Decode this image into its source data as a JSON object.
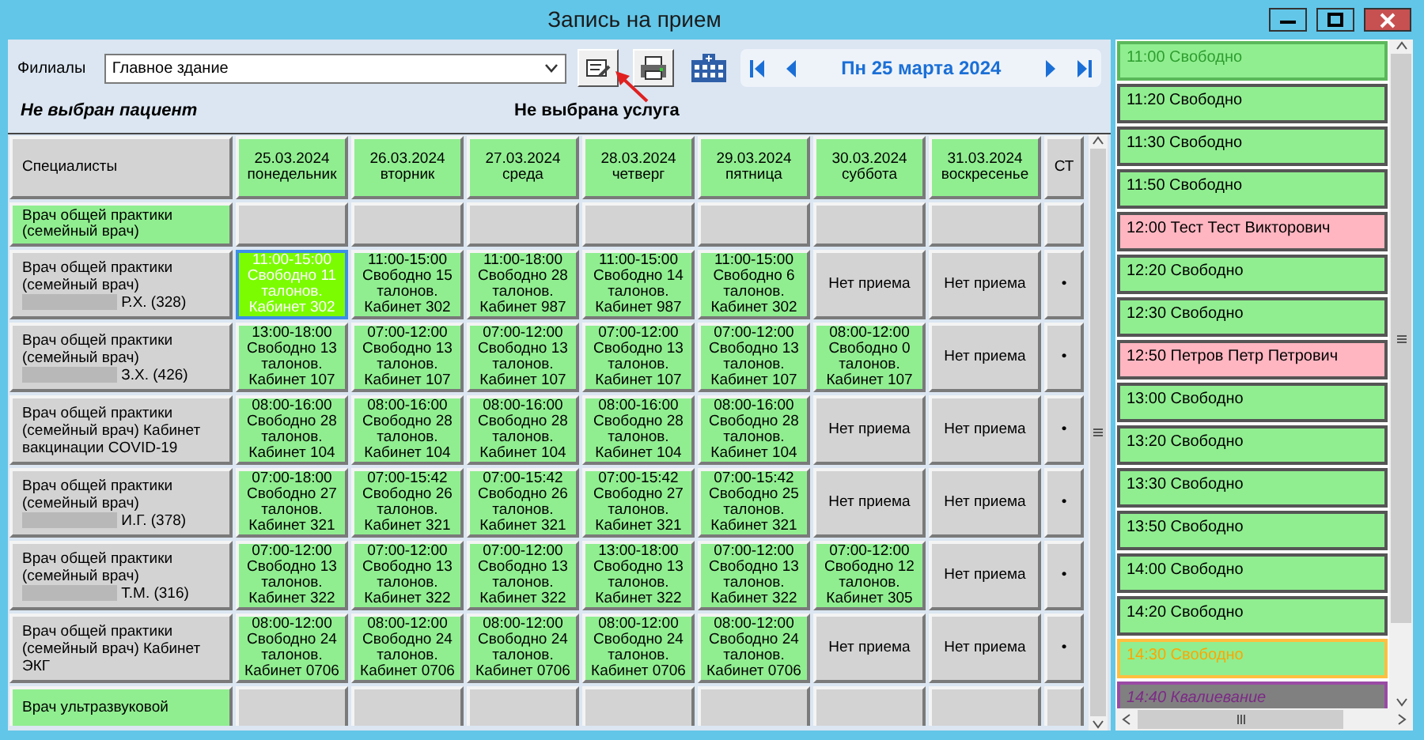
{
  "window": {
    "title": "Запись на прием"
  },
  "toolbar": {
    "branch_label": "Филиалы",
    "branch_value": "Главное здание",
    "date": "Пн 25 марта 2024"
  },
  "status": {
    "patient": "Не выбран пациент",
    "service": "Не выбрана услуга"
  },
  "table": {
    "columns": [
      {
        "kind": "spec",
        "lines": [
          "Специалисты"
        ]
      },
      {
        "kind": "day",
        "lines": [
          "25.03.2024",
          "понедельник"
        ]
      },
      {
        "kind": "day",
        "lines": [
          "26.03.2024",
          "вторник"
        ]
      },
      {
        "kind": "day",
        "lines": [
          "27.03.2024",
          "среда"
        ]
      },
      {
        "kind": "day",
        "lines": [
          "28.03.2024",
          "четверг"
        ]
      },
      {
        "kind": "day",
        "lines": [
          "29.03.2024",
          "пятница"
        ]
      },
      {
        "kind": "day",
        "lines": [
          "30.03.2024",
          "суббота"
        ]
      },
      {
        "kind": "day",
        "lines": [
          "31.03.2024",
          "воскресенье"
        ]
      },
      {
        "kind": "st",
        "lines": [
          "СТ"
        ]
      }
    ],
    "rows": [
      {
        "kind": "group",
        "name": "Врач общей практики (семейный врач)"
      },
      {
        "kind": "doctor",
        "name": "Врач общей практики (семейный врач)",
        "redacted": true,
        "initials": "Р.Х. (328)",
        "cells": [
          {
            "kind": "slot",
            "selected": true,
            "lines": [
              "11:00-15:00",
              "Свободно 11",
              "талонов.",
              "Кабинет 302"
            ]
          },
          {
            "kind": "slot",
            "selected": false,
            "lines": [
              "11:00-15:00",
              "Свободно 15",
              "талонов.",
              "Кабинет 302"
            ]
          },
          {
            "kind": "slot",
            "selected": false,
            "lines": [
              "11:00-18:00",
              "Свободно 28",
              "талонов.",
              "Кабинет 987"
            ]
          },
          {
            "kind": "slot",
            "selected": false,
            "lines": [
              "11:00-15:00",
              "Свободно 14",
              "талонов.",
              "Кабинет 987"
            ]
          },
          {
            "kind": "slot",
            "selected": false,
            "lines": [
              "11:00-15:00",
              "Свободно 6",
              "талонов.",
              "Кабинет 302"
            ]
          },
          {
            "kind": "none",
            "selected": false,
            "lines": [
              "Нет приема"
            ]
          },
          {
            "kind": "none",
            "selected": false,
            "lines": [
              "Нет приема"
            ]
          },
          {
            "kind": "st",
            "selected": false,
            "lines": [
              "•"
            ]
          }
        ]
      },
      {
        "kind": "doctor",
        "name": "Врач общей практики (семейный врач)",
        "redacted": true,
        "initials": "З.Х. (426)",
        "cells": [
          {
            "kind": "slot",
            "selected": false,
            "lines": [
              "13:00-18:00",
              "Свободно 13",
              "талонов.",
              "Кабинет 107"
            ]
          },
          {
            "kind": "slot",
            "selected": false,
            "lines": [
              "07:00-12:00",
              "Свободно 13",
              "талонов.",
              "Кабинет 107"
            ]
          },
          {
            "kind": "slot",
            "selected": false,
            "lines": [
              "07:00-12:00",
              "Свободно 13",
              "талонов.",
              "Кабинет 107"
            ]
          },
          {
            "kind": "slot",
            "selected": false,
            "lines": [
              "07:00-12:00",
              "Свободно 13",
              "талонов.",
              "Кабинет 107"
            ]
          },
          {
            "kind": "slot",
            "selected": false,
            "lines": [
              "07:00-12:00",
              "Свободно 13",
              "талонов.",
              "Кабинет 107"
            ]
          },
          {
            "kind": "slot",
            "selected": false,
            "lines": [
              "08:00-12:00",
              "Свободно 0",
              "талонов.",
              "Кабинет 107"
            ]
          },
          {
            "kind": "none",
            "selected": false,
            "lines": [
              "Нет приема"
            ]
          },
          {
            "kind": "st",
            "selected": false,
            "lines": [
              "•"
            ]
          }
        ]
      },
      {
        "kind": "doctor",
        "name": "Врач общей практики (семейный врач) Кабинет вакцинации COVID-19",
        "redacted": false,
        "cells": [
          {
            "kind": "slot",
            "selected": false,
            "lines": [
              "08:00-16:00",
              "Свободно 28",
              "талонов.",
              "Кабинет 104"
            ]
          },
          {
            "kind": "slot",
            "selected": false,
            "lines": [
              "08:00-16:00",
              "Свободно 28",
              "талонов.",
              "Кабинет 104"
            ]
          },
          {
            "kind": "slot",
            "selected": false,
            "lines": [
              "08:00-16:00",
              "Свободно 28",
              "талонов.",
              "Кабинет 104"
            ]
          },
          {
            "kind": "slot",
            "selected": false,
            "lines": [
              "08:00-16:00",
              "Свободно 28",
              "талонов.",
              "Кабинет 104"
            ]
          },
          {
            "kind": "slot",
            "selected": false,
            "lines": [
              "08:00-16:00",
              "Свободно 28",
              "талонов.",
              "Кабинет 104"
            ]
          },
          {
            "kind": "none",
            "selected": false,
            "lines": [
              "Нет приема"
            ]
          },
          {
            "kind": "none",
            "selected": false,
            "lines": [
              "Нет приема"
            ]
          },
          {
            "kind": "st",
            "selected": false,
            "lines": [
              "•"
            ]
          }
        ]
      },
      {
        "kind": "doctor",
        "name": "Врач общей практики (семейный врач)",
        "redacted": true,
        "initials": "И.Г. (378)",
        "cells": [
          {
            "kind": "slot",
            "selected": false,
            "lines": [
              "07:00-18:00",
              "Свободно 27",
              "талонов.",
              "Кабинет 321"
            ]
          },
          {
            "kind": "slot",
            "selected": false,
            "lines": [
              "07:00-15:42",
              "Свободно 26",
              "талонов.",
              "Кабинет 321"
            ]
          },
          {
            "kind": "slot",
            "selected": false,
            "lines": [
              "07:00-15:42",
              "Свободно 26",
              "талонов.",
              "Кабинет 321"
            ]
          },
          {
            "kind": "slot",
            "selected": false,
            "lines": [
              "07:00-15:42",
              "Свободно 27",
              "талонов.",
              "Кабинет 321"
            ]
          },
          {
            "kind": "slot",
            "selected": false,
            "lines": [
              "07:00-15:42",
              "Свободно 25",
              "талонов.",
              "Кабинет 321"
            ]
          },
          {
            "kind": "none",
            "selected": false,
            "lines": [
              "Нет приема"
            ]
          },
          {
            "kind": "none",
            "selected": false,
            "lines": [
              "Нет приема"
            ]
          },
          {
            "kind": "st",
            "selected": false,
            "lines": [
              "•"
            ]
          }
        ]
      },
      {
        "kind": "doctor",
        "name": "Врач общей практики (семейный врач)",
        "redacted": true,
        "initials": "Т.М. (316)",
        "cells": [
          {
            "kind": "slot",
            "selected": false,
            "lines": [
              "07:00-12:00",
              "Свободно 13",
              "талонов.",
              "Кабинет 322"
            ]
          },
          {
            "kind": "slot",
            "selected": false,
            "lines": [
              "07:00-12:00",
              "Свободно 13",
              "талонов.",
              "Кабинет 322"
            ]
          },
          {
            "kind": "slot",
            "selected": false,
            "lines": [
              "07:00-12:00",
              "Свободно 13",
              "талонов.",
              "Кабинет 322"
            ]
          },
          {
            "kind": "slot",
            "selected": false,
            "lines": [
              "13:00-18:00",
              "Свободно 13",
              "талонов.",
              "Кабинет 322"
            ]
          },
          {
            "kind": "slot",
            "selected": false,
            "lines": [
              "07:00-12:00",
              "Свободно 13",
              "талонов.",
              "Кабинет 322"
            ]
          },
          {
            "kind": "slot",
            "selected": false,
            "lines": [
              "07:00-12:00",
              "Свободно 12",
              "талонов.",
              "Кабинет 305"
            ]
          },
          {
            "kind": "none",
            "selected": false,
            "lines": [
              "Нет приема"
            ]
          },
          {
            "kind": "st",
            "selected": false,
            "lines": [
              "•"
            ]
          }
        ]
      },
      {
        "kind": "doctor",
        "name": "Врач общей практики (семейный врач) Кабинет ЭКГ",
        "redacted": false,
        "cells": [
          {
            "kind": "slot",
            "selected": false,
            "lines": [
              "08:00-12:00",
              "Свободно 24",
              "талонов.",
              "Кабинет 0706"
            ]
          },
          {
            "kind": "slot",
            "selected": false,
            "lines": [
              "08:00-12:00",
              "Свободно 24",
              "талонов.",
              "Кабинет 0706"
            ]
          },
          {
            "kind": "slot",
            "selected": false,
            "lines": [
              "08:00-12:00",
              "Свободно 24",
              "талонов.",
              "Кабинет 0706"
            ]
          },
          {
            "kind": "slot",
            "selected": false,
            "lines": [
              "08:00-12:00",
              "Свободно 24",
              "талонов.",
              "Кабинет 0706"
            ]
          },
          {
            "kind": "slot",
            "selected": false,
            "lines": [
              "08:00-12:00",
              "Свободно 24",
              "талонов.",
              "Кабинет 0706"
            ]
          },
          {
            "kind": "none",
            "selected": false,
            "lines": [
              "Нет приема"
            ]
          },
          {
            "kind": "none",
            "selected": false,
            "lines": [
              "Нет приема"
            ]
          },
          {
            "kind": "st",
            "selected": false,
            "lines": [
              "•"
            ]
          }
        ]
      },
      {
        "kind": "group",
        "name": "Врач ультразвуковой"
      }
    ]
  },
  "time_slots": [
    {
      "kind": "selected",
      "time": "11:00",
      "label": "Свободно"
    },
    {
      "kind": "free",
      "time": "11:20",
      "label": "Свободно"
    },
    {
      "kind": "free",
      "time": "11:30",
      "label": "Свободно"
    },
    {
      "kind": "free",
      "time": "11:50",
      "label": "Свободно"
    },
    {
      "kind": "booked",
      "time": "12:00",
      "label": "Тест Тест Викторович"
    },
    {
      "kind": "free",
      "time": "12:20",
      "label": "Свободно"
    },
    {
      "kind": "free",
      "time": "12:30",
      "label": "Свободно"
    },
    {
      "kind": "booked",
      "time": "12:50",
      "label": "Петров Петр Петрович"
    },
    {
      "kind": "free",
      "time": "13:00",
      "label": "Свободно"
    },
    {
      "kind": "free",
      "time": "13:20",
      "label": "Свободно"
    },
    {
      "kind": "free",
      "time": "13:30",
      "label": "Свободно"
    },
    {
      "kind": "free",
      "time": "13:50",
      "label": "Свободно"
    },
    {
      "kind": "free",
      "time": "14:00",
      "label": "Свободно"
    },
    {
      "kind": "free",
      "time": "14:20",
      "label": "Свободно"
    },
    {
      "kind": "current",
      "time": "14:30",
      "label": "Свободно"
    },
    {
      "kind": "break",
      "time": "14:40",
      "label": "Квалиевание"
    }
  ]
}
